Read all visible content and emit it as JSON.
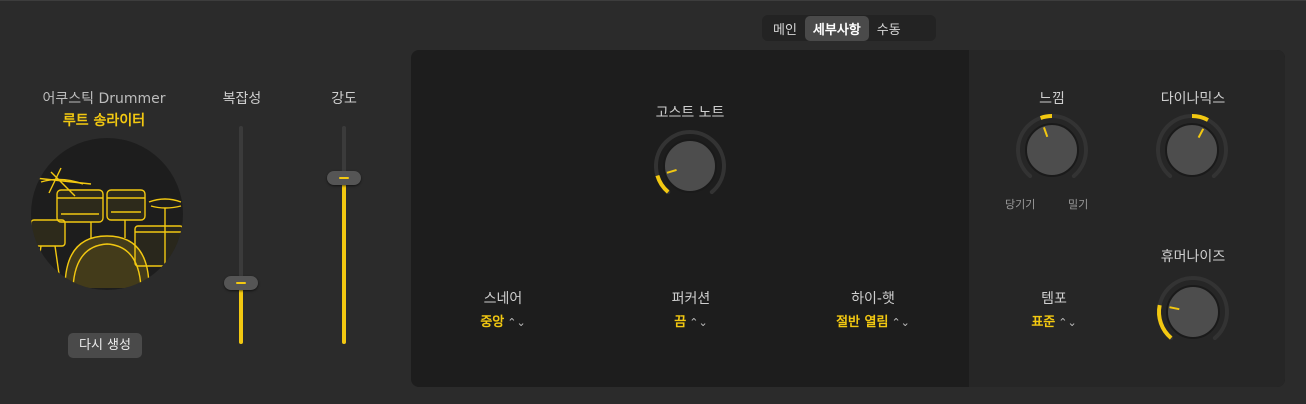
{
  "tabs": [
    {
      "label": "메인"
    },
    {
      "label": "세부사항"
    },
    {
      "label": "수동"
    }
  ],
  "drummer": {
    "name": "어쿠스틱 Drummer",
    "style": "루트 송라이터",
    "regenerate_label": "다시 생성"
  },
  "sliders": {
    "complexity": {
      "label": "복잡성",
      "level": 0.28
    },
    "loudness": {
      "label": "강도",
      "level": 0.76
    }
  },
  "controls": {
    "ghost_notes": {
      "label": "고스트 노트",
      "level": 0.12
    },
    "snare": {
      "label": "스네어",
      "value": "중앙"
    },
    "percussion": {
      "label": "퍼커션",
      "value": "끔"
    },
    "hihat": {
      "label": "하이-햇",
      "value": "절반 열림"
    },
    "feel": {
      "label": "느낌",
      "left_label": "당기기",
      "right_label": "밀기",
      "level": 0.43
    },
    "dynamics": {
      "label": "다이나믹스",
      "level": 0.6
    },
    "tempo": {
      "label": "템포",
      "value": "표준"
    },
    "humanize": {
      "label": "휴머나이즈",
      "level": 0.22
    }
  },
  "colors": {
    "accent": "#f2c811",
    "panel": "#1d1d1d",
    "background": "#2b2b2b"
  },
  "icons": {
    "kit": "drum-kit-icon",
    "updown": "updown-arrows-icon"
  }
}
